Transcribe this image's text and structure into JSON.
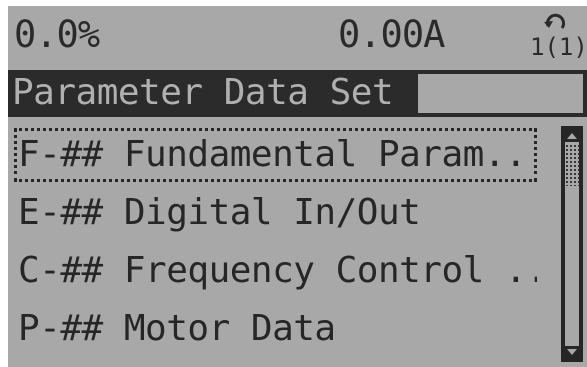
{
  "status": {
    "left_value": "0.0%",
    "center_value": "0.00A",
    "setup_label": "1(1)",
    "setup_icon": "rotate-arrow-icon"
  },
  "title": {
    "text": "Parameter Data Set"
  },
  "menu": {
    "items": [
      {
        "label": "F-## Fundamental Param...",
        "selected": true
      },
      {
        "label": "E-## Digital In/Out",
        "selected": false
      },
      {
        "label": "C-## Frequency Control ...",
        "selected": false
      },
      {
        "label": "P-## Motor Data",
        "selected": false
      }
    ]
  },
  "scrollbar": {
    "position_fraction": 0.0
  },
  "colors": {
    "lcd_background": "#a8a8a8",
    "ink": "#262626",
    "title_background": "#2b2b2b"
  }
}
